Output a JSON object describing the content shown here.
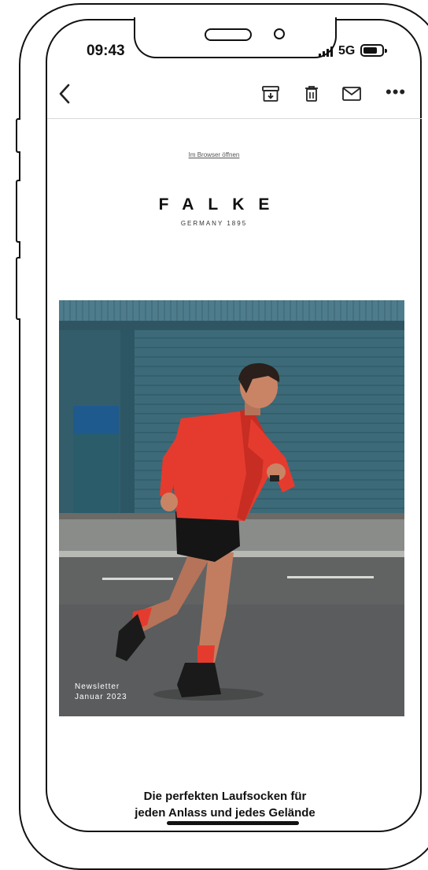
{
  "status_bar": {
    "time": "09:43",
    "network": "5G"
  },
  "toolbar": {
    "back_icon": "chevron-left-icon",
    "actions": [
      "archive-icon",
      "trash-icon",
      "envelope-icon",
      "more-icon"
    ],
    "more_label": "•••"
  },
  "email": {
    "open_in_browser": "Im Browser öffnen",
    "brand": "FALKE",
    "brand_sub": "GERMANY 1895",
    "hero": {
      "caption_line1": "Newsletter",
      "caption_line2": "Januar 2023"
    },
    "headline_line1": "Die perfekten Laufsocken für",
    "headline_line2": "jeden Anlass und jedes Gelände"
  },
  "colors": {
    "accent_red": "#e53b2e",
    "shutter_teal": "#3d6a78",
    "asphalt": "#5a5c5d"
  }
}
